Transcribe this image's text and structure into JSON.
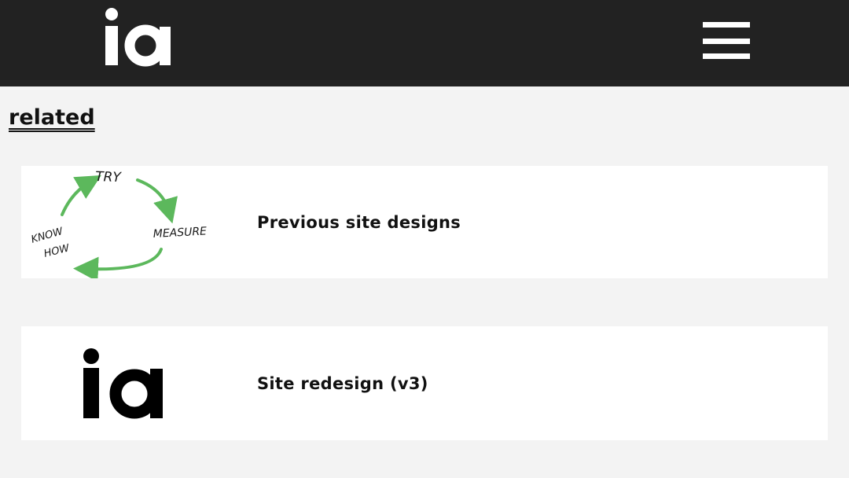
{
  "header": {
    "logo_text": "ia",
    "menu_icon": "hamburger-menu-icon",
    "bg_color": "#222222"
  },
  "related": {
    "title": "related",
    "items": [
      {
        "title": "Previous site designs",
        "thumbnail": {
          "type": "hand-drawn cycle diagram",
          "labels": [
            "TRY",
            "MEASURE",
            "KNOW",
            "HOW"
          ],
          "arrow_color": "#5cb85c"
        }
      },
      {
        "title": "Site redesign (v3)",
        "thumbnail": {
          "type": "logo",
          "logo_text": "ia"
        }
      }
    ]
  }
}
